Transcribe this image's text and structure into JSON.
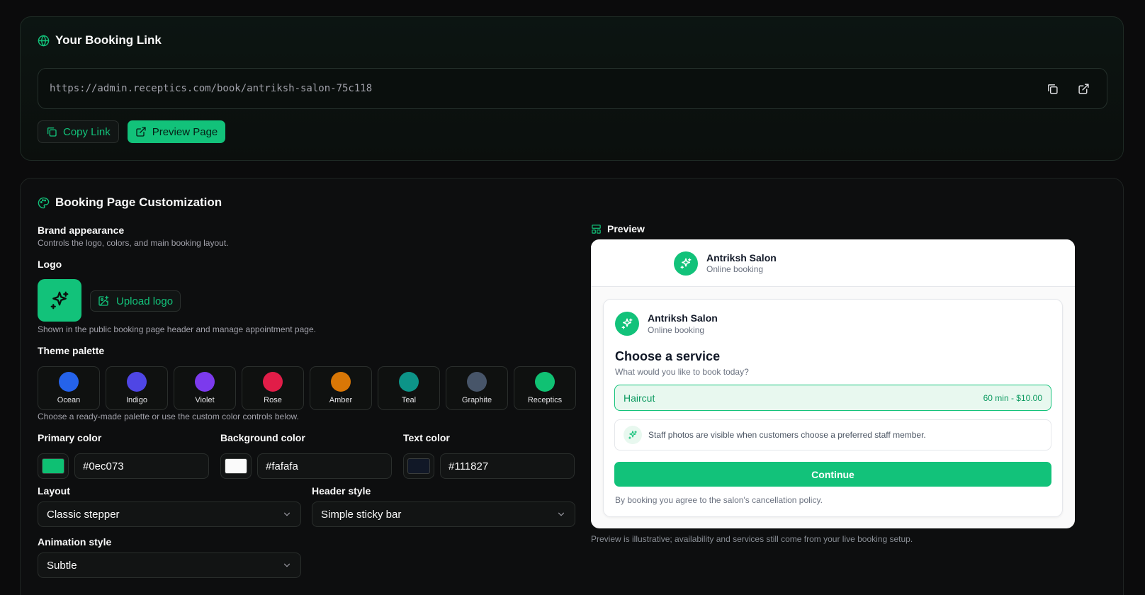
{
  "booking_link": {
    "title": "Your Booking Link",
    "title_icon": "globe-icon",
    "url": "https://admin.receptics.com/book/antriksh-salon-75c118",
    "copy_icon": "copy-icon",
    "open_icon": "external-link-icon",
    "copy_label": "Copy Link",
    "preview_label": "Preview Page"
  },
  "customization": {
    "title": "Booking Page Customization",
    "title_icon": "palette-icon",
    "brand": {
      "heading": "Brand appearance",
      "subheading": "Controls the logo, colors, and main booking layout."
    },
    "logo": {
      "label": "Logo",
      "upload_label": "Upload logo",
      "hint": "Shown in the public booking page header and manage appointment page."
    },
    "theme": {
      "label": "Theme palette",
      "hint": "Choose a ready-made palette or use the custom color controls below.",
      "swatches": [
        {
          "name": "Ocean",
          "color": "#2563eb"
        },
        {
          "name": "Indigo",
          "color": "#4f46e5"
        },
        {
          "name": "Violet",
          "color": "#7c3aed"
        },
        {
          "name": "Rose",
          "color": "#e11d48"
        },
        {
          "name": "Amber",
          "color": "#d97706"
        },
        {
          "name": "Teal",
          "color": "#0d9488"
        },
        {
          "name": "Graphite",
          "color": "#475569"
        },
        {
          "name": "Receptics",
          "color": "#10c173"
        }
      ]
    },
    "colors": {
      "primary_label": "Primary color",
      "primary_value": "#0ec073",
      "background_label": "Background color",
      "background_value": "#fafafa",
      "text_label": "Text color",
      "text_value": "#111827"
    },
    "layout": {
      "label": "Layout",
      "value": "Classic stepper"
    },
    "header_style": {
      "label": "Header style",
      "value": "Simple sticky bar"
    },
    "animation": {
      "label": "Animation style",
      "value": "Subtle"
    }
  },
  "preview": {
    "title": "Preview",
    "title_icon": "layout-icon",
    "salon_name": "Antriksh Salon",
    "salon_sub": "Online booking",
    "heading": "Choose a service",
    "question": "What would you like to book today?",
    "service_name": "Haircut",
    "service_meta": "60 min - $10.00",
    "staff_note": "Staff photos are visible when customers choose a preferred staff member.",
    "continue_label": "Continue",
    "policy": "By booking you agree to the salon's cancellation policy.",
    "footnote": "Preview is illustrative; availability and services still come from your live booking setup."
  },
  "colors": {
    "accent": "#12c27a",
    "page_bg": "#0b0b0c"
  }
}
